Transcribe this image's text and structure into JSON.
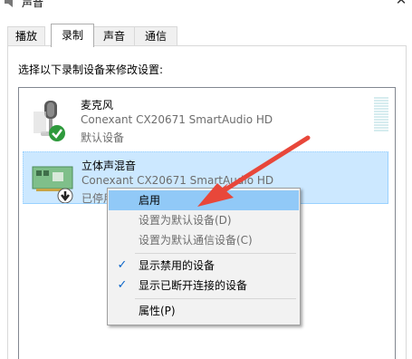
{
  "window": {
    "title": "声音"
  },
  "tabs": [
    {
      "label": "播放"
    },
    {
      "label": "录制"
    },
    {
      "label": "声音"
    },
    {
      "label": "通信"
    }
  ],
  "instruction": "选择以下录制设备来修改设置:",
  "devices": [
    {
      "name": "麦克风",
      "description": "Conexant CX20671 SmartAudio HD",
      "status": "默认设备"
    },
    {
      "name": "立体声混音",
      "description": "Conexant CX20671 SmartAudio HD",
      "status": "已停用"
    }
  ],
  "context_menu": {
    "items": [
      {
        "label": "启用"
      },
      {
        "label": "设置为默认设备(D)"
      },
      {
        "label": "设置为默认通信设备(C)"
      },
      {
        "label": "显示禁用的设备"
      },
      {
        "label": "显示已断开连接的设备"
      },
      {
        "label": "属性(P)"
      }
    ],
    "check_glyph": "✓"
  },
  "colors": {
    "selection": "#cce8ff",
    "menu_hover": "#91c9f7",
    "annotation_arrow": "#e8473a",
    "default_badge": "#2e9a3c"
  }
}
